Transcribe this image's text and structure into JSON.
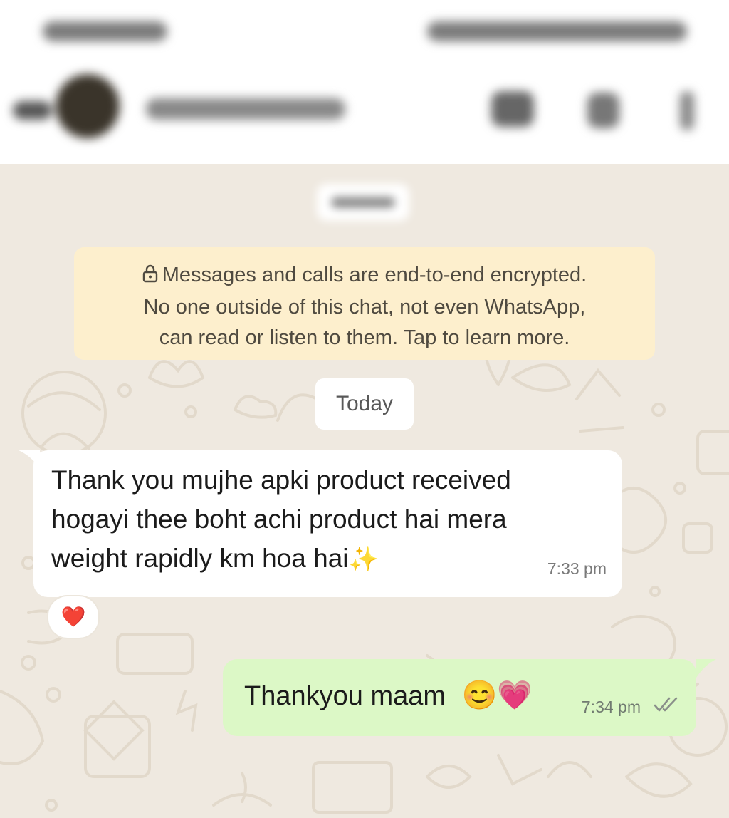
{
  "encryption_notice": {
    "lines": [
      "Messages and calls are end-to-end encrypted.",
      "No one outside of this chat, not even WhatsApp,",
      "can read or listen to them. Tap to learn more."
    ],
    "icon": "lock-icon"
  },
  "date_separator": "Today",
  "messages": [
    {
      "direction": "incoming",
      "lines": [
        "Thank you mujhe apki product received",
        "hogayi thee boht achi product hai mera",
        "weight rapidly km hoa hai"
      ],
      "emoji": "✨",
      "time": "7:33 pm",
      "reaction": "❤️"
    },
    {
      "direction": "outgoing",
      "text": "Thankyou maam",
      "emojis": "😊💗",
      "time": "7:34 pm",
      "status": "read"
    }
  ],
  "colors": {
    "wallpaper": "#efe9e0",
    "incoming_bubble": "#ffffff",
    "outgoing_bubble": "#dcf8c6",
    "encryption_bg": "#fdefcd"
  }
}
